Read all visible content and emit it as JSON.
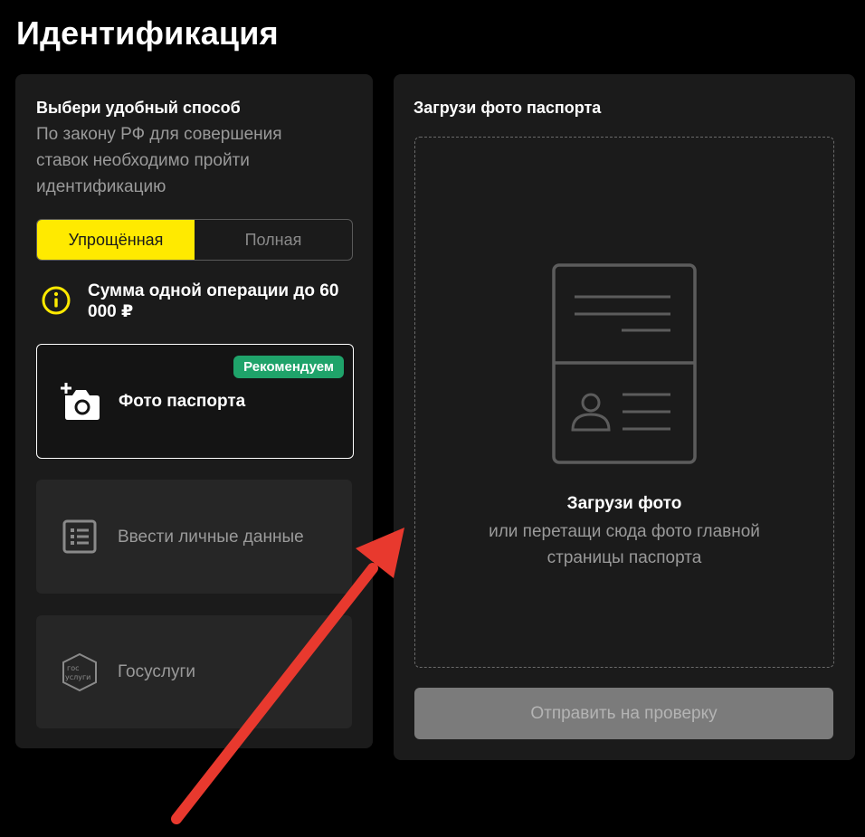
{
  "page": {
    "title": "Идентификация"
  },
  "left_panel": {
    "title": "Выбери удобный способ",
    "subtitle": "По закону РФ для совершения ставок необходимо пройти идентификацию",
    "toggle": {
      "simplified": "Упрощённая",
      "full": "Полная",
      "active": "simplified"
    },
    "limit_text": "Сумма одной операции до 60 000 ₽",
    "methods": {
      "passport": {
        "label": "Фото паспорта",
        "badge": "Рекомендуем",
        "icon": "add-photo-camera-icon"
      },
      "manual": {
        "label": "Ввести личные данные",
        "icon": "form-list-icon"
      },
      "gosuslugi": {
        "label": "Госуслуги",
        "icon": "gosuslugi-logo-icon",
        "logo_text_top": "гос",
        "logo_text_bottom": "услуги"
      }
    }
  },
  "right_panel": {
    "title": "Загрузи фото паспорта",
    "dropzone": {
      "title": "Загрузи фото",
      "hint": "или перетащи сюда фото главной страницы паспорта",
      "icon": "passport-illustration-icon"
    },
    "submit_label": "Отправить на проверку"
  },
  "colors": {
    "accent_yellow": "#ffea00",
    "badge_green": "#1fa36a",
    "panel_bg": "#1b1b1b",
    "annotation_arrow": "#e8392e"
  }
}
